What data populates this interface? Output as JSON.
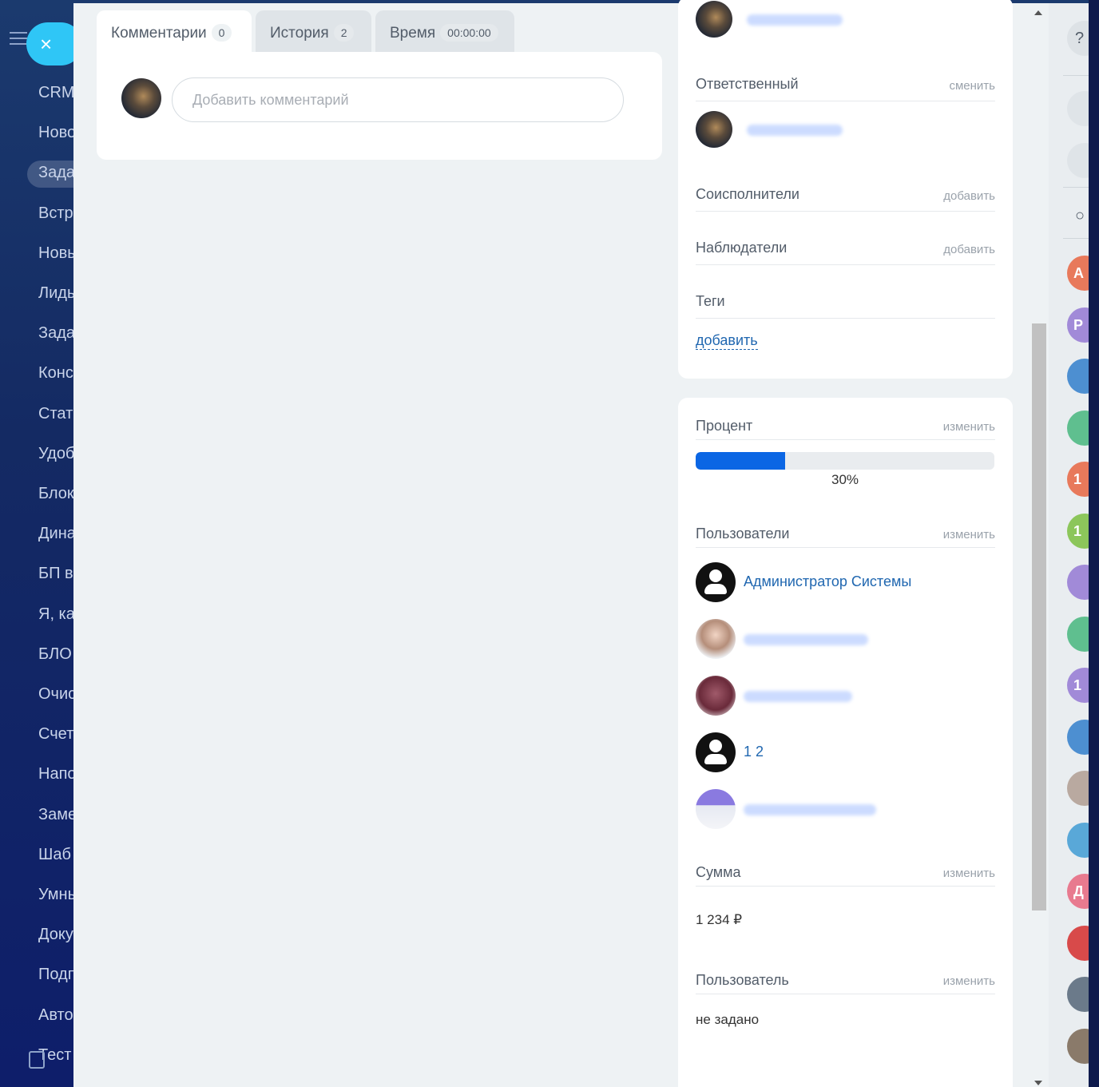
{
  "leftnav": {
    "items": [
      "CRM",
      "Ново",
      "Зада",
      "Встр",
      "Новы",
      "Лиды",
      "Зада",
      "Конс",
      "Стат",
      "Удоб",
      "Блок",
      "Дина",
      "БП в",
      "Я, ка",
      "БЛО",
      "Очис",
      "Счет",
      "Напо",
      "Заме",
      "Шаб",
      "Умны",
      "Доку",
      "Подп",
      "Авто",
      "Тест"
    ],
    "close_label": "×"
  },
  "tabs": [
    {
      "label": "Комментарии",
      "count": "0"
    },
    {
      "label": "История",
      "count": "2"
    },
    {
      "label": "Время",
      "count": "00:00:00"
    }
  ],
  "comment": {
    "placeholder": "Добавить комментарий"
  },
  "people": {
    "responsible_label": "Ответственный",
    "responsible_action": "сменить",
    "coexecutors_label": "Соисполнители",
    "coexecutors_action": "добавить",
    "observers_label": "Наблюдатели",
    "observers_action": "добавить",
    "tags_label": "Теги",
    "tags_action": "добавить"
  },
  "fields": {
    "percent_label": "Процент",
    "percent_action": "изменить",
    "percent_value": 30,
    "percent_text": "30%",
    "users_label": "Пользователи",
    "users_action": "изменить",
    "users": [
      "Администратор Системы",
      "1 2"
    ],
    "sum_label": "Сумма",
    "sum_action": "изменить",
    "sum_value": "1 234 ₽",
    "user_label": "Пользователь",
    "user_action": "изменить",
    "user_value": "не задано"
  },
  "rightbar": {
    "help": "?",
    "search": "○",
    "badges": [
      {
        "text": "А",
        "color": "#e8795b"
      },
      {
        "text": "Р",
        "color": "#a18ad8"
      },
      {
        "text": "",
        "color": "#4d8fd1"
      },
      {
        "text": "",
        "color": "#5fbf8f"
      },
      {
        "text": "1",
        "color": "#e8795b"
      },
      {
        "text": "1",
        "color": "#8cc65b"
      },
      {
        "text": "",
        "color": "#a18ad8"
      },
      {
        "text": "",
        "color": "#5fbf8f"
      },
      {
        "text": "1",
        "color": "#a18ad8"
      },
      {
        "text": "",
        "color": "#4d8fd1"
      },
      {
        "text": "",
        "color": "#b9a9a0"
      },
      {
        "text": "",
        "color": "#59a8d8"
      },
      {
        "text": "Д",
        "color": "#e87a8f"
      },
      {
        "text": "",
        "color": "#d84a4a"
      },
      {
        "text": "",
        "color": "#6b7a8a"
      },
      {
        "text": "",
        "color": "#8a7a6a"
      }
    ]
  }
}
